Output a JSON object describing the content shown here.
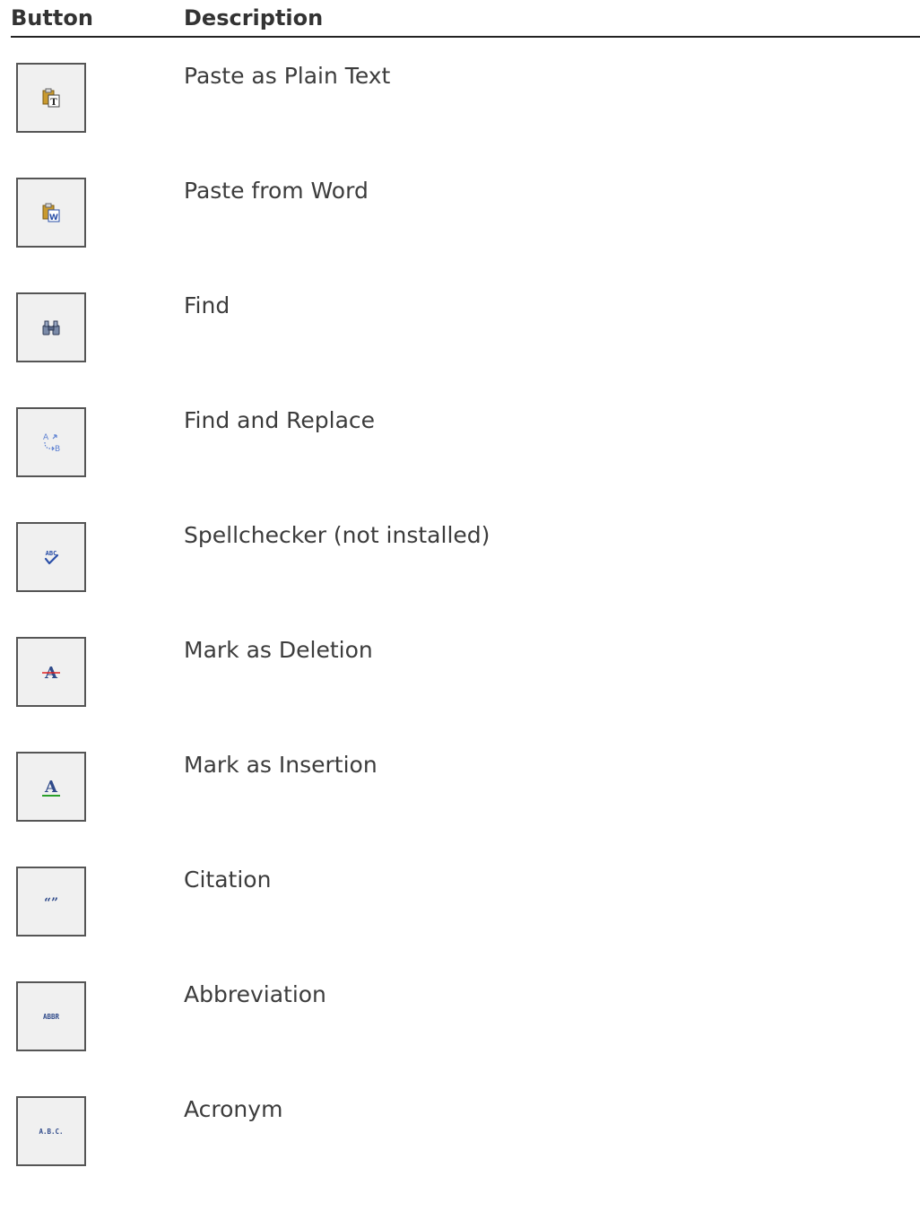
{
  "table": {
    "headers": {
      "button": "Button",
      "description": "Description"
    },
    "rows": [
      {
        "icon": "paste-plain-text-icon",
        "description": "Paste as Plain Text"
      },
      {
        "icon": "paste-from-word-icon",
        "description": "Paste from Word"
      },
      {
        "icon": "find-binoculars-icon",
        "description": "Find"
      },
      {
        "icon": "find-replace-icon",
        "description": "Find and Replace"
      },
      {
        "icon": "spellcheck-icon",
        "description": "Spellchecker (not installed)"
      },
      {
        "icon": "strikethrough-deletion-icon",
        "description": "Mark as Deletion"
      },
      {
        "icon": "underline-insertion-icon",
        "description": "Mark as Insertion"
      },
      {
        "icon": "citation-quotes-icon",
        "description": "Citation"
      },
      {
        "icon": "abbreviation-icon",
        "description": "Abbreviation"
      },
      {
        "icon": "acronym-icon",
        "description": "Acronym"
      }
    ],
    "icon_labels": {
      "abbreviation": "ABBR",
      "acronym": "A.B.C.",
      "spellcheck": "ABC"
    },
    "colors": {
      "button_border": "#555555",
      "button_bg": "#f0f0f0",
      "icon_blue": "#2a4fa8",
      "deletion_red": "#e02020",
      "insertion_green": "#2aa02a",
      "clipboard_gold": "#c99a2e"
    }
  }
}
